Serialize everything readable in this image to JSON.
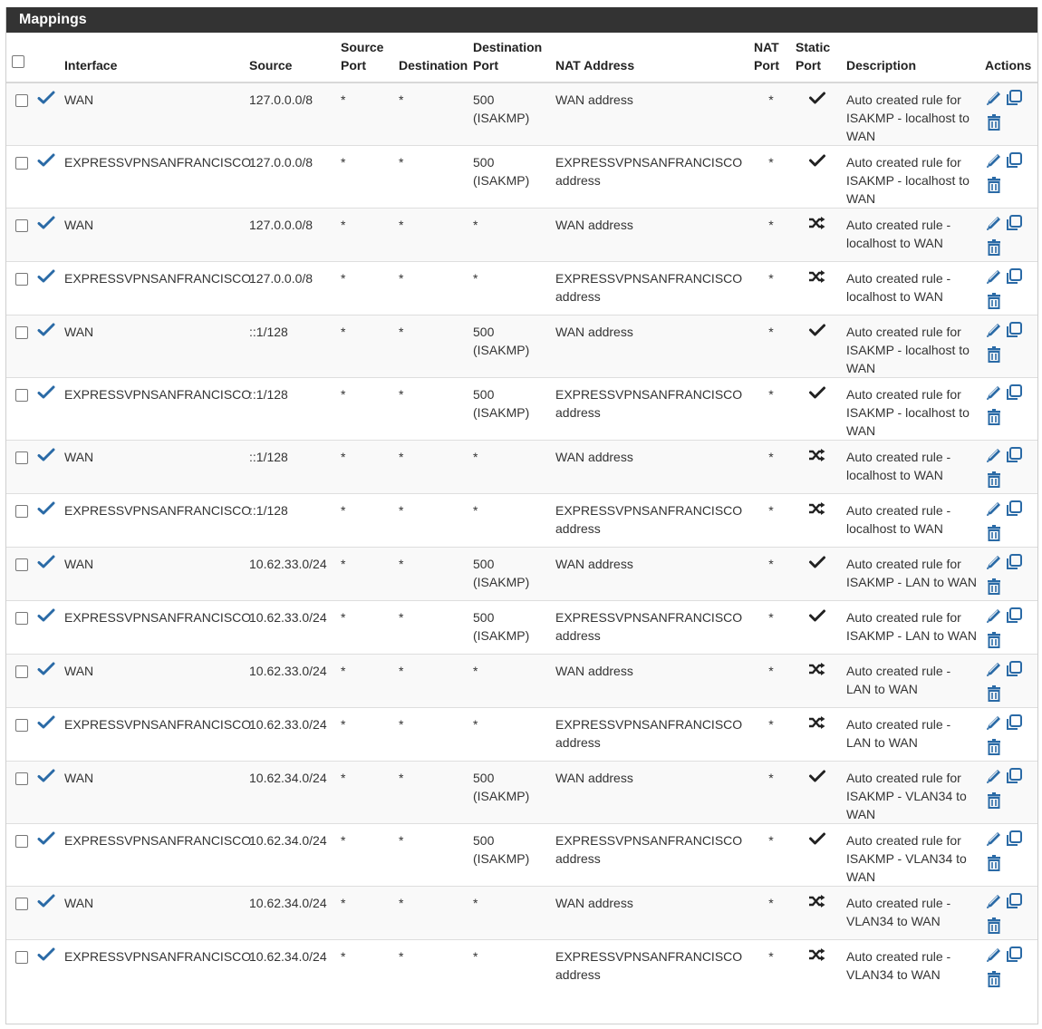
{
  "panel": {
    "title": "Mappings"
  },
  "columns": {
    "interface": "Interface",
    "source": "Source",
    "source_port": "Source Port",
    "destination": "Destination",
    "destination_port": "Destination Port",
    "nat_address": "NAT Address",
    "nat_port": "NAT Port",
    "static_port": "Static Port",
    "description": "Description",
    "actions": "Actions"
  },
  "icons": {
    "enabled": "check-icon",
    "static_yes": "checkmark-icon",
    "static_no": "shuffle-icon",
    "edit": "pencil-icon",
    "copy": "copy-icon",
    "delete": "trash-icon"
  },
  "colors": {
    "header_bg": "#333333",
    "accent": "#2a6aa6"
  },
  "rows": [
    {
      "interface": "WAN",
      "source": "127.0.0.0/8",
      "source_port": "*",
      "destination": "*",
      "dest_port": "500 (ISAKMP)",
      "nat_address": "WAN address",
      "nat_port": "*",
      "static": "yes",
      "description": "Auto created rule for ISAKMP - localhost to WAN"
    },
    {
      "interface": "EXPRESSVPNSANFRANCISCO",
      "source": "127.0.0.0/8",
      "source_port": "*",
      "destination": "*",
      "dest_port": "500 (ISAKMP)",
      "nat_address": "EXPRESSVPNSANFRANCISCO address",
      "nat_port": "*",
      "static": "yes",
      "description": "Auto created rule for ISAKMP - localhost to WAN"
    },
    {
      "interface": "WAN",
      "source": "127.0.0.0/8",
      "source_port": "*",
      "destination": "*",
      "dest_port": "*",
      "nat_address": "WAN address",
      "nat_port": "*",
      "static": "no",
      "description": "Auto created rule - localhost to WAN"
    },
    {
      "interface": "EXPRESSVPNSANFRANCISCO",
      "source": "127.0.0.0/8",
      "source_port": "*",
      "destination": "*",
      "dest_port": "*",
      "nat_address": "EXPRESSVPNSANFRANCISCO address",
      "nat_port": "*",
      "static": "no",
      "description": "Auto created rule - localhost to WAN"
    },
    {
      "interface": "WAN",
      "source": "::1/128",
      "source_port": "*",
      "destination": "*",
      "dest_port": "500 (ISAKMP)",
      "nat_address": "WAN address",
      "nat_port": "*",
      "static": "yes",
      "description": "Auto created rule for ISAKMP - localhost to WAN"
    },
    {
      "interface": "EXPRESSVPNSANFRANCISCO",
      "source": "::1/128",
      "source_port": "*",
      "destination": "*",
      "dest_port": "500 (ISAKMP)",
      "nat_address": "EXPRESSVPNSANFRANCISCO address",
      "nat_port": "*",
      "static": "yes",
      "description": "Auto created rule for ISAKMP - localhost to WAN"
    },
    {
      "interface": "WAN",
      "source": "::1/128",
      "source_port": "*",
      "destination": "*",
      "dest_port": "*",
      "nat_address": "WAN address",
      "nat_port": "*",
      "static": "no",
      "description": "Auto created rule - localhost to WAN"
    },
    {
      "interface": "EXPRESSVPNSANFRANCISCO",
      "source": "::1/128",
      "source_port": "*",
      "destination": "*",
      "dest_port": "*",
      "nat_address": "EXPRESSVPNSANFRANCISCO address",
      "nat_port": "*",
      "static": "no",
      "description": "Auto created rule - localhost to WAN"
    },
    {
      "interface": "WAN",
      "source": "10.62.33.0/24",
      "source_port": "*",
      "destination": "*",
      "dest_port": "500 (ISAKMP)",
      "nat_address": "WAN address",
      "nat_port": "*",
      "static": "yes",
      "description": "Auto created rule for ISAKMP - LAN to WAN"
    },
    {
      "interface": "EXPRESSVPNSANFRANCISCO",
      "source": "10.62.33.0/24",
      "source_port": "*",
      "destination": "*",
      "dest_port": "500 (ISAKMP)",
      "nat_address": "EXPRESSVPNSANFRANCISCO address",
      "nat_port": "*",
      "static": "yes",
      "description": "Auto created rule for ISAKMP - LAN to WAN"
    },
    {
      "interface": "WAN",
      "source": "10.62.33.0/24",
      "source_port": "*",
      "destination": "*",
      "dest_port": "*",
      "nat_address": "WAN address",
      "nat_port": "*",
      "static": "no",
      "description": "Auto created rule - LAN to WAN"
    },
    {
      "interface": "EXPRESSVPNSANFRANCISCO",
      "source": "10.62.33.0/24",
      "source_port": "*",
      "destination": "*",
      "dest_port": "*",
      "nat_address": "EXPRESSVPNSANFRANCISCO address",
      "nat_port": "*",
      "static": "no",
      "description": "Auto created rule - LAN to WAN"
    },
    {
      "interface": "WAN",
      "source": "10.62.34.0/24",
      "source_port": "*",
      "destination": "*",
      "dest_port": "500 (ISAKMP)",
      "nat_address": "WAN address",
      "nat_port": "*",
      "static": "yes",
      "description": "Auto created rule for ISAKMP - VLAN34 to WAN"
    },
    {
      "interface": "EXPRESSVPNSANFRANCISCO",
      "source": "10.62.34.0/24",
      "source_port": "*",
      "destination": "*",
      "dest_port": "500 (ISAKMP)",
      "nat_address": "EXPRESSVPNSANFRANCISCO address",
      "nat_port": "*",
      "static": "yes",
      "description": "Auto created rule for ISAKMP - VLAN34 to WAN"
    },
    {
      "interface": "WAN",
      "source": "10.62.34.0/24",
      "source_port": "*",
      "destination": "*",
      "dest_port": "*",
      "nat_address": "WAN address",
      "nat_port": "*",
      "static": "no",
      "description": "Auto created rule - VLAN34 to WAN"
    },
    {
      "interface": "EXPRESSVPNSANFRANCISCO",
      "source": "10.62.34.0/24",
      "source_port": "*",
      "destination": "*",
      "dest_port": "*",
      "nat_address": "EXPRESSVPNSANFRANCISCO address",
      "nat_port": "*",
      "static": "no",
      "description": "Auto created rule - VLAN34 to WAN"
    }
  ]
}
